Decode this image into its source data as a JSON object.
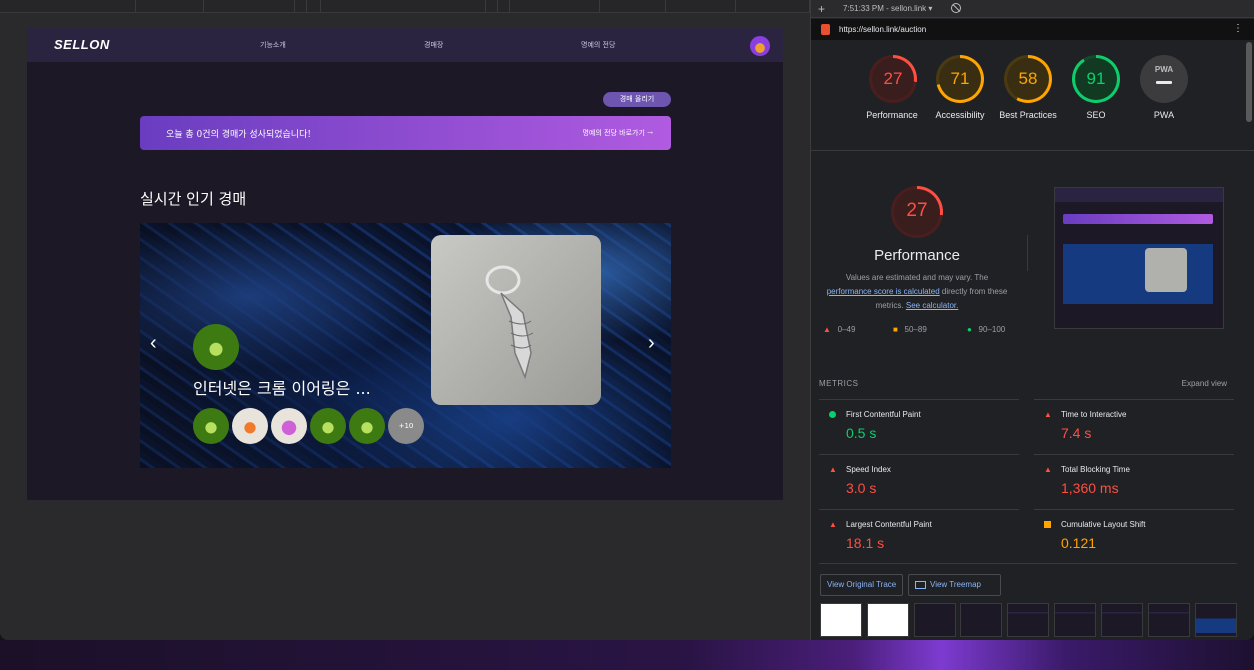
{
  "devtools": {
    "time_tab": "7:51:33 PM - sellon.link ▾",
    "url": "https://sellon.link/auction",
    "scores": [
      {
        "label": "Performance",
        "value": "27",
        "color": "#ff4e42"
      },
      {
        "label": "Accessibility",
        "value": "71",
        "color": "#ffa400"
      },
      {
        "label": "Best Practices",
        "value": "58",
        "color": "#ffa400"
      },
      {
        "label": "SEO",
        "value": "91",
        "color": "#0cce6b"
      },
      {
        "label": "PWA",
        "value": "PWA",
        "color": "#9aa0a6"
      }
    ],
    "performance": {
      "score": "27",
      "title": "Performance",
      "desc_1": "Values are estimated and may vary. The",
      "link_1": "performance score is calculated",
      "desc_2": "directly from these metrics.",
      "link_2": "See calculator."
    },
    "legend": [
      "0–49",
      "50–89",
      "90–100"
    ],
    "metrics_heading": "METRICS",
    "expand_view": "Expand view",
    "metrics": [
      {
        "label": "First Contentful Paint",
        "value": "0.5 s",
        "status": "good"
      },
      {
        "label": "Time to Interactive",
        "value": "7.4 s",
        "status": "poor"
      },
      {
        "label": "Speed Index",
        "value": "3.0 s",
        "status": "poor"
      },
      {
        "label": "Total Blocking Time",
        "value": "1,360 ms",
        "status": "poor"
      },
      {
        "label": "Largest Contentful Paint",
        "value": "18.1 s",
        "status": "poor"
      },
      {
        "label": "Cumulative Layout Shift",
        "value": "0.121",
        "status": "average"
      }
    ],
    "view_trace": "View Original Trace",
    "view_treemap": "View Treemap"
  },
  "site": {
    "logo": "SELLON",
    "nav": [
      "기능소개",
      "경매장",
      "명예의 전당"
    ],
    "upload_button": "경매 올리기",
    "banner_text": "오늘 총 0건의 경매가 성사되었습니다!",
    "banner_link": "명예의 전당 바로가기 →",
    "section_title": "실시간 인기 경매",
    "product_title": "인터넷은 크롬 이어링은 ...",
    "more_bidders": "+10"
  }
}
